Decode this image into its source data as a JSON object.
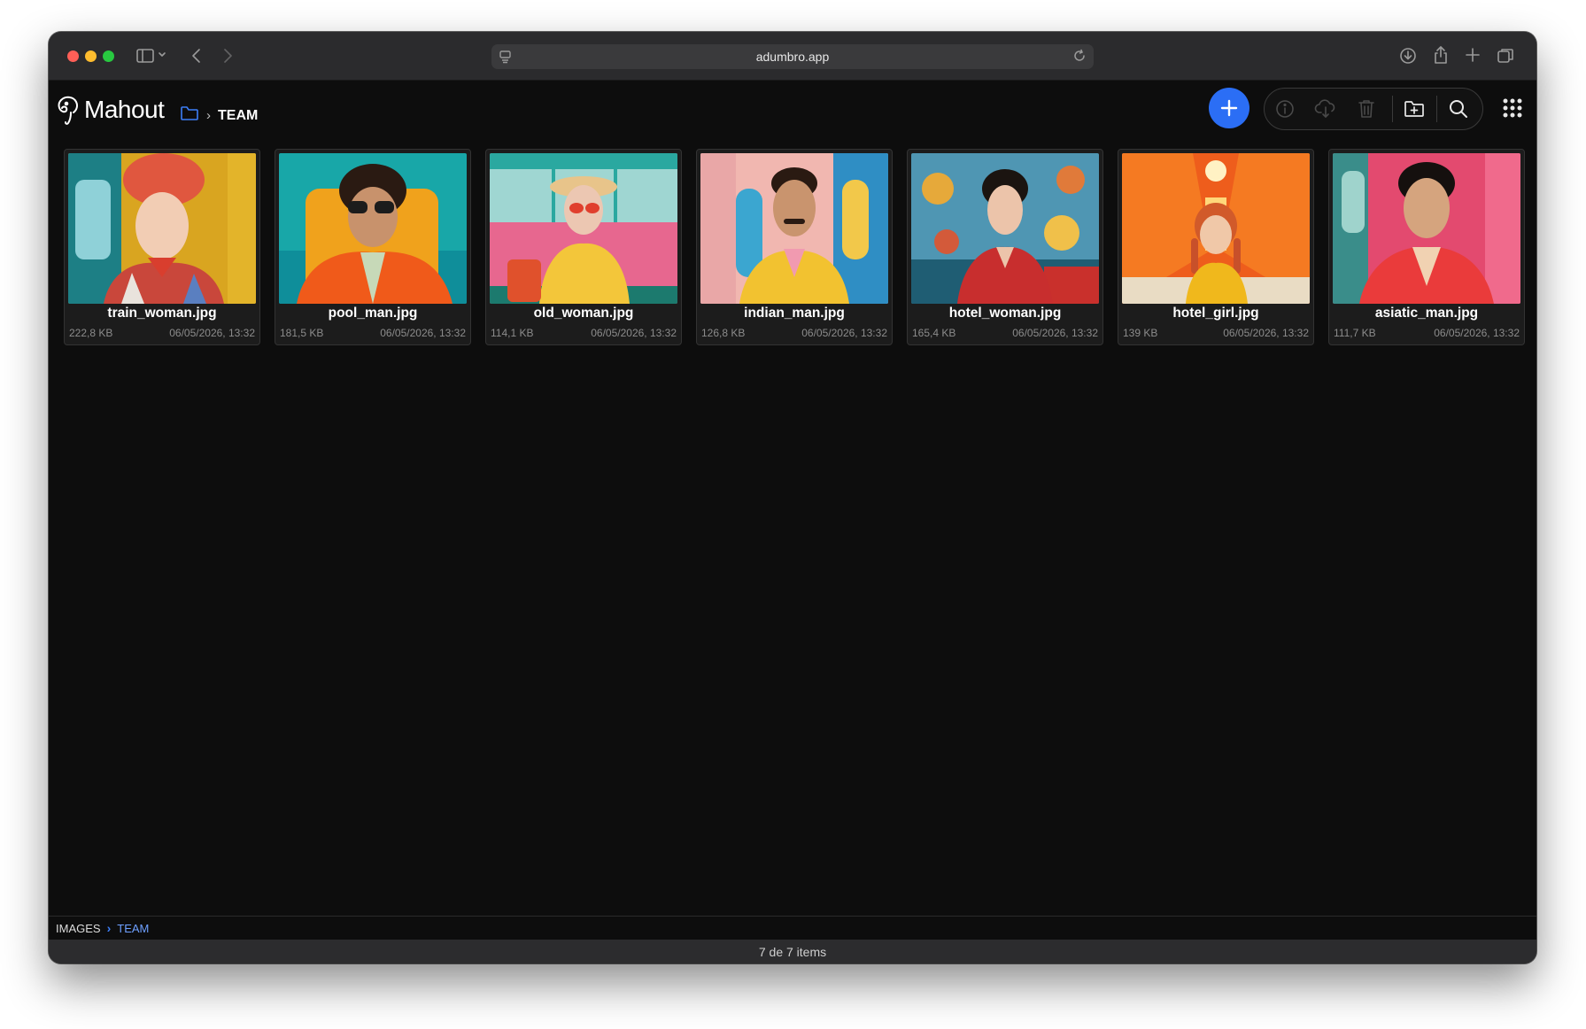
{
  "browser": {
    "url": "adumbro.app"
  },
  "app": {
    "name": "Mahout",
    "current_folder": "TEAM",
    "accent_color": "#2b6ef5"
  },
  "toolbar": {
    "add_icon": "plus-icon",
    "info_icon": "info-icon",
    "download_icon": "cloud-download-icon",
    "delete_icon": "trash-icon",
    "new_folder_icon": "folder-plus-icon",
    "search_icon": "search-icon",
    "apps_icon": "grid-icon"
  },
  "files": [
    {
      "name": "train_woman.jpg",
      "size": "222,8 KB",
      "date": "06/05/2026, 13:32"
    },
    {
      "name": "pool_man.jpg",
      "size": "181,5 KB",
      "date": "06/05/2026, 13:32"
    },
    {
      "name": "old_woman.jpg",
      "size": "114,1 KB",
      "date": "06/05/2026, 13:32"
    },
    {
      "name": "indian_man.jpg",
      "size": "126,8 KB",
      "date": "06/05/2026, 13:32"
    },
    {
      "name": "hotel_woman.jpg",
      "size": "165,4 KB",
      "date": "06/05/2026, 13:32"
    },
    {
      "name": "hotel_girl.jpg",
      "size": "139 KB",
      "date": "06/05/2026, 13:32"
    },
    {
      "name": "asiatic_man.jpg",
      "size": "111,7 KB",
      "date": "06/05/2026, 13:32"
    }
  ],
  "pathbar": {
    "root": "IMAGES",
    "current": "TEAM"
  },
  "status": {
    "items_text": "7 de 7 items"
  }
}
